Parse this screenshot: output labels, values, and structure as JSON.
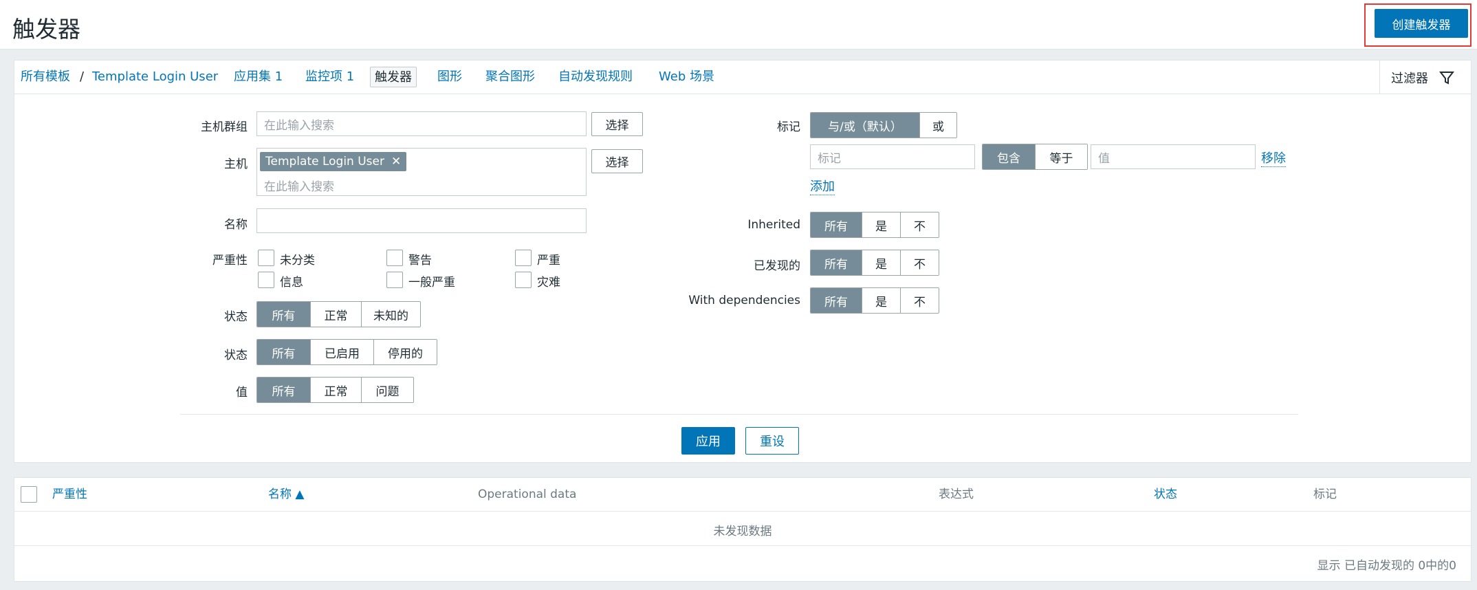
{
  "header": {
    "title": "触发器",
    "create_button": "创建触发器"
  },
  "nav": {
    "breadcrumb_root": "所有模板",
    "separator": "/",
    "host": "Template Login User",
    "app_sets": "应用集 1",
    "items": "监控项 1",
    "triggers": "触发器",
    "graphs": "图形",
    "screens": "聚合图形",
    "discovery": "自动发现规则",
    "web": "Web 场景",
    "filter_tab": "过滤器"
  },
  "filter": {
    "host_groups_label": "主机群组",
    "host_groups_placeholder": "在此输入搜索",
    "select_label": "选择",
    "host_label": "主机",
    "host_chip": "Template Login User",
    "host_placeholder": "在此输入搜索",
    "name_label": "名称",
    "name_value": "",
    "severity_label": "严重性",
    "severities": [
      "未分类",
      "警告",
      "严重",
      "信息",
      "一般严重",
      "灾难"
    ],
    "state_label": "状态",
    "state_options": [
      "所有",
      "正常",
      "未知的"
    ],
    "status_label": "状态",
    "status_options": [
      "所有",
      "已启用",
      "停用的"
    ],
    "value_label": "值",
    "value_options": [
      "所有",
      "正常",
      "问题"
    ],
    "tags_label": "标记",
    "tags_mode": [
      "与/或（默认）",
      "或"
    ],
    "tag_placeholder": "标记",
    "tag_ops": [
      "包含",
      "等于"
    ],
    "tag_value_placeholder": "值",
    "remove_link": "移除",
    "add_link": "添加",
    "inherited_label": "Inherited",
    "discovered_label": "已发现的",
    "dependencies_label": "With dependencies",
    "yes_no_options": [
      "所有",
      "是",
      "不"
    ],
    "apply_button": "应用",
    "reset_button": "重设"
  },
  "table": {
    "columns": [
      "严重性",
      "名称 ▲",
      "Operational data",
      "表达式",
      "状态",
      "标记"
    ],
    "empty_message": "未发现数据",
    "footer": "显示 已自动发现的 0中的0"
  }
}
